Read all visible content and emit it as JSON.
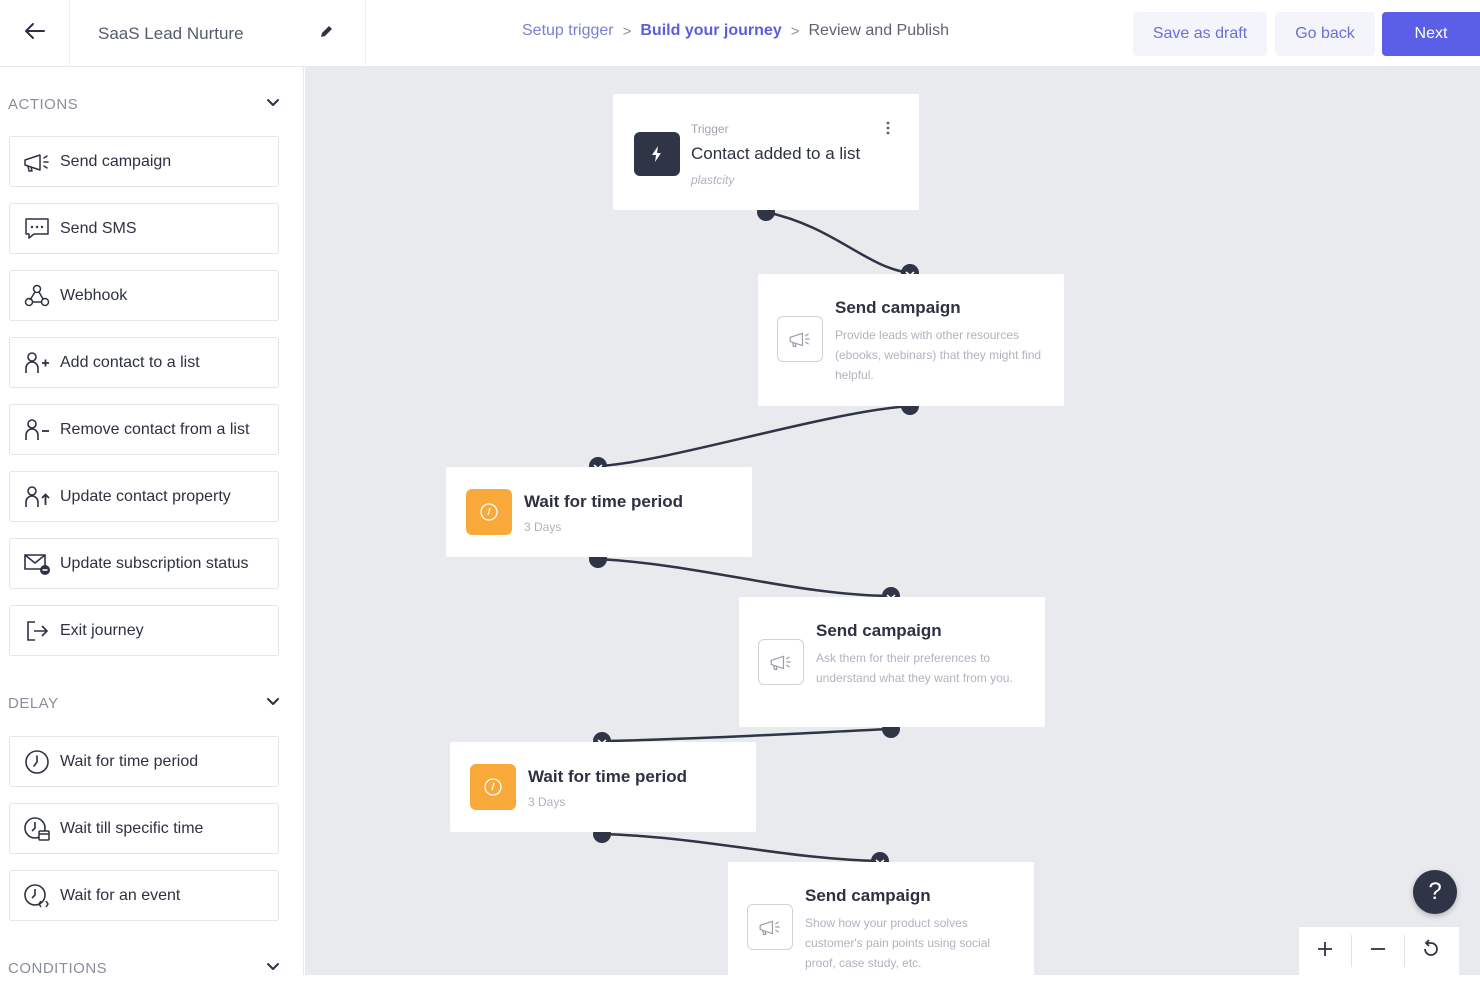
{
  "header": {
    "back_icon": "arrow-left-icon",
    "journey_title": "SaaS Lead Nurture",
    "edit_icon": "pencil-icon",
    "breadcrumb": [
      {
        "label": "Setup trigger",
        "state": "done"
      },
      {
        "label": "Build your journey",
        "state": "active"
      },
      {
        "label": "Review and Publish",
        "state": "future"
      }
    ],
    "breadcrumb_separator": ">",
    "save_draft_label": "Save as draft",
    "go_back_label": "Go back",
    "next_label": "Next"
  },
  "sidebar": {
    "actions_heading": "ACTIONS",
    "actions": [
      {
        "label": "Send campaign",
        "icon": "megaphone-icon"
      },
      {
        "label": "Send SMS",
        "icon": "sms-icon"
      },
      {
        "label": "Webhook",
        "icon": "webhook-icon"
      },
      {
        "label": "Add contact to a list",
        "icon": "user-plus-icon"
      },
      {
        "label": "Remove contact from a list",
        "icon": "user-minus-icon"
      },
      {
        "label": "Update contact property",
        "icon": "user-up-icon"
      },
      {
        "label": "Update subscription status",
        "icon": "mail-status-icon"
      },
      {
        "label": "Exit journey",
        "icon": "exit-icon"
      }
    ],
    "delay_heading": "DELAY",
    "delays": [
      {
        "label": "Wait for time period",
        "icon": "clock-icon"
      },
      {
        "label": "Wait till specific time",
        "icon": "clock-calendar-icon"
      },
      {
        "label": "Wait for an event",
        "icon": "clock-event-icon"
      }
    ],
    "conditions_heading": "CONDITIONS"
  },
  "canvas": {
    "trigger": {
      "kicker": "Trigger",
      "title": "Contact added to a list",
      "subtitle": "plastcity",
      "icon": "lightning-icon"
    },
    "campaigns": [
      {
        "title": "Send campaign",
        "description": "Provide leads with other resources (ebooks, webinars) that they might find helpful."
      },
      {
        "title": "Send campaign",
        "description": "Ask them for their preferences to understand what they want from you."
      },
      {
        "title": "Send campaign",
        "description": "Show how your product solves customer's pain points using social proof, case study, etc."
      }
    ],
    "waits": [
      {
        "title": "Wait for time period",
        "duration": "3 Days"
      },
      {
        "title": "Wait for time period",
        "duration": "3 Days"
      }
    ],
    "help_label": "?",
    "colors": {
      "accent": "#5b5fe8",
      "dark": "#2f3446",
      "wait": "#f8a93a",
      "canvas_bg": "#e9eaee"
    }
  }
}
